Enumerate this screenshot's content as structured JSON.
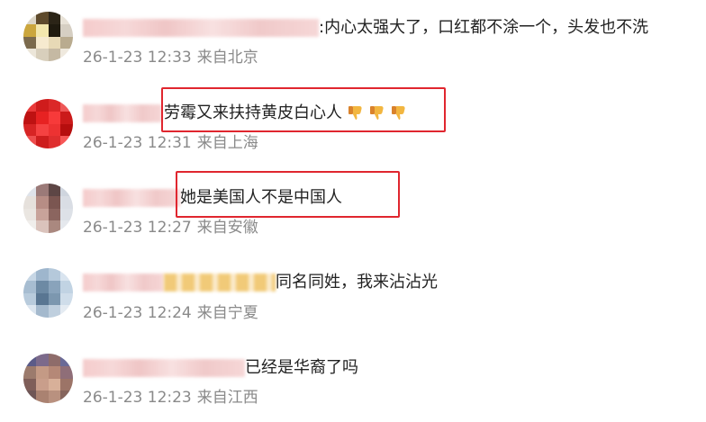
{
  "comments": [
    {
      "text": ":内心太强大了，口红都不涂一个，头发也不洗",
      "time": "26-1-23 12:33",
      "location": "来自北京",
      "avatar_colors": [
        "#dcd6c8",
        "#5d4a2e",
        "#2b2418",
        "#e8e2d8",
        "#c9a642",
        "#f2e7b0",
        "#1f1a10",
        "#d6cfc4",
        "#7a6a4e",
        "#f5ead0",
        "#e6d9b8",
        "#b8ab90",
        "#ece6da",
        "#d8cfbd",
        "#c4b9a4",
        "#efe9df"
      ]
    },
    {
      "text": "劳霉又来扶持黄皮白心人",
      "time": "26-1-23 12:31",
      "location": "来自上海",
      "emoji_icons": [
        "thumbs-down-icon",
        "thumbs-down-icon",
        "thumbs-down-icon"
      ],
      "avatar_colors": [
        "#e23b3b",
        "#c81e1e",
        "#d42a2a",
        "#e85a5a",
        "#b81414",
        "#e02424",
        "#f03c3c",
        "#c41c1c",
        "#d02626",
        "#ee4444",
        "#e63434",
        "#b01010",
        "#e85050",
        "#c62020",
        "#d83030",
        "#f05858"
      ]
    },
    {
      "text": "她是美国人不是中国人",
      "time": "26-1-23 12:27",
      "location": "来自安徽",
      "avatar_colors": [
        "#dfe3ea",
        "#9a7a78",
        "#5c4645",
        "#cfd5de",
        "#e6e1dc",
        "#b58d86",
        "#7a5652",
        "#d9dde4",
        "#eae6e1",
        "#c7a39b",
        "#8a6560",
        "#dde1e7",
        "#f0eeeb",
        "#d9c3bd",
        "#a98880",
        "#e5e8ed"
      ]
    },
    {
      "text": "同名同姓，我来沾沾光",
      "time": "26-1-23 12:24",
      "location": "来自宁夏",
      "avatar_colors": [
        "#c7d6e4",
        "#9fb6cc",
        "#b6c9da",
        "#d9e4ee",
        "#a8bdd0",
        "#6e8aa3",
        "#8aa3ba",
        "#c2d3e2",
        "#b9cbdb",
        "#5a7690",
        "#7d97ae",
        "#d0dde9",
        "#dbe5ee",
        "#a5b9cc",
        "#c0cfdd",
        "#e4ebf2"
      ]
    },
    {
      "text": "已经是华裔了吗",
      "time": "26-1-23 12:23",
      "location": "来自江西",
      "avatar_colors": [
        "#5b5b86",
        "#7b6a8a",
        "#8d6c6a",
        "#6a6a95",
        "#9b7b6e",
        "#c29a86",
        "#b38878",
        "#8e6e78",
        "#7e5e5a",
        "#c79e8c",
        "#d6b09a",
        "#9a7468",
        "#6e5656",
        "#a88272",
        "#b79180",
        "#85655e"
      ]
    }
  ],
  "colors": {
    "highlight": "#e0262f",
    "meta_text": "#8a8a8a"
  }
}
